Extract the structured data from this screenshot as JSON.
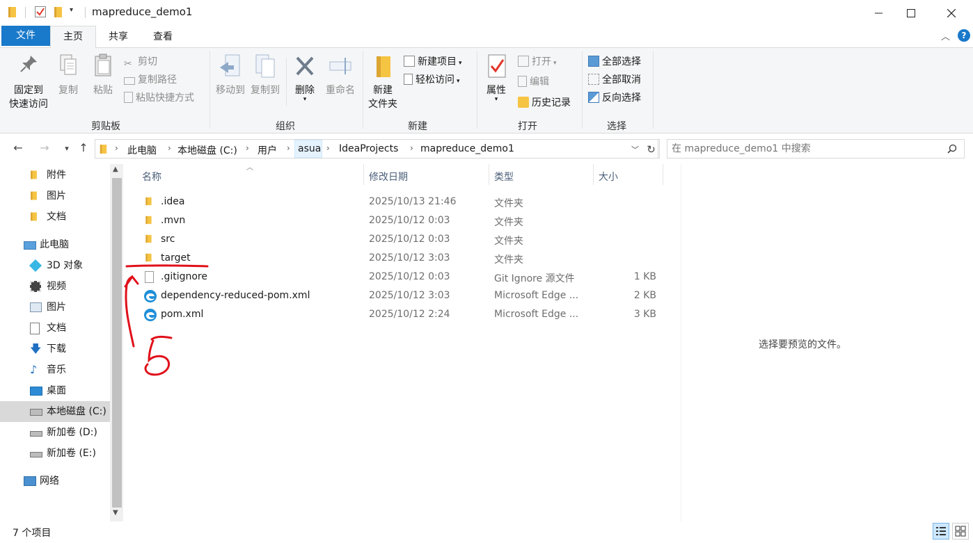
{
  "window": {
    "title": "mapreduce_demo1",
    "minimize_icon": "minimize-icon",
    "maximize_icon": "maximize-icon",
    "close_icon": "close-icon"
  },
  "ribbon_tabs": [
    "文件",
    "主页",
    "共享",
    "查看"
  ],
  "ribbon": {
    "clipboard": {
      "pin": "固定到\n快速访问",
      "pin_line1": "固定到",
      "pin_line2": "快速访问",
      "copy": "复制",
      "paste": "粘贴",
      "cut": "剪切",
      "copy_path": "复制路径",
      "paste_shortcut": "粘贴快捷方式",
      "label": "剪贴板"
    },
    "organize": {
      "move_to": "移动到",
      "copy_to": "复制到",
      "delete": "删除",
      "rename": "重命名",
      "label": "组织"
    },
    "new": {
      "new_folder_line1": "新建",
      "new_folder_line2": "文件夹",
      "new_item": "新建项目",
      "easy_access": "轻松访问",
      "label": "新建"
    },
    "open": {
      "properties": "属性",
      "open": "打开",
      "edit": "编辑",
      "history": "历史记录",
      "label": "打开"
    },
    "select": {
      "select_all": "全部选择",
      "select_none": "全部取消",
      "invert": "反向选择",
      "label": "选择"
    }
  },
  "breadcrumb": [
    "此电脑",
    "本地磁盘 (C:)",
    "用户",
    "asua",
    "IdeaProjects",
    "mapreduce_demo1"
  ],
  "search": {
    "placeholder": "在 mapreduce_demo1 中搜索"
  },
  "nav_pane": {
    "quick": [
      {
        "label": "附件",
        "icon": "folder-icon"
      },
      {
        "label": "图片",
        "icon": "folder-icon"
      },
      {
        "label": "文档",
        "icon": "folder-icon"
      }
    ],
    "this_pc": {
      "label": "此电脑",
      "icon": "computer-icon"
    },
    "pc_items": [
      {
        "label": "3D 对象",
        "icon": "3d-objects-icon"
      },
      {
        "label": "视频",
        "icon": "video-icon"
      },
      {
        "label": "图片",
        "icon": "pictures-icon"
      },
      {
        "label": "文档",
        "icon": "documents-icon"
      },
      {
        "label": "下载",
        "icon": "download-icon"
      },
      {
        "label": "音乐",
        "icon": "music-icon"
      },
      {
        "label": "桌面",
        "icon": "desktop-icon"
      },
      {
        "label": "本地磁盘 (C:)",
        "icon": "drive-c-icon",
        "selected": true
      },
      {
        "label": "新加卷 (D:)",
        "icon": "drive-icon"
      },
      {
        "label": "新加卷 (E:)",
        "icon": "drive-icon"
      }
    ],
    "network": {
      "label": "网络",
      "icon": "network-icon"
    }
  },
  "columns": {
    "name": "名称",
    "date": "修改日期",
    "type": "类型",
    "size": "大小"
  },
  "files": [
    {
      "name": ".idea",
      "date": "2025/10/13 21:46",
      "type": "文件夹",
      "size": "",
      "icon": "folder-icon"
    },
    {
      "name": ".mvn",
      "date": "2025/10/12 0:03",
      "type": "文件夹",
      "size": "",
      "icon": "folder-icon"
    },
    {
      "name": "src",
      "date": "2025/10/12 0:03",
      "type": "文件夹",
      "size": "",
      "icon": "folder-icon"
    },
    {
      "name": "target",
      "date": "2025/10/12 3:03",
      "type": "文件夹",
      "size": "",
      "icon": "folder-icon"
    },
    {
      "name": ".gitignore",
      "date": "2025/10/12 0:03",
      "type": "Git Ignore 源文件",
      "size": "1 KB",
      "icon": "file-icon"
    },
    {
      "name": "dependency-reduced-pom.xml",
      "date": "2025/10/12 3:03",
      "type": "Microsoft Edge ...",
      "size": "2 KB",
      "icon": "edge-icon"
    },
    {
      "name": "pom.xml",
      "date": "2025/10/12 2:24",
      "type": "Microsoft Edge ...",
      "size": "3 KB",
      "icon": "edge-icon"
    }
  ],
  "preview": {
    "message": "选择要预览的文件。"
  },
  "status": {
    "count": "7 个项目"
  },
  "colors": {
    "accent": "#1979ca",
    "selected_bg": "#cce8ff",
    "annotation": "#e0101a"
  }
}
